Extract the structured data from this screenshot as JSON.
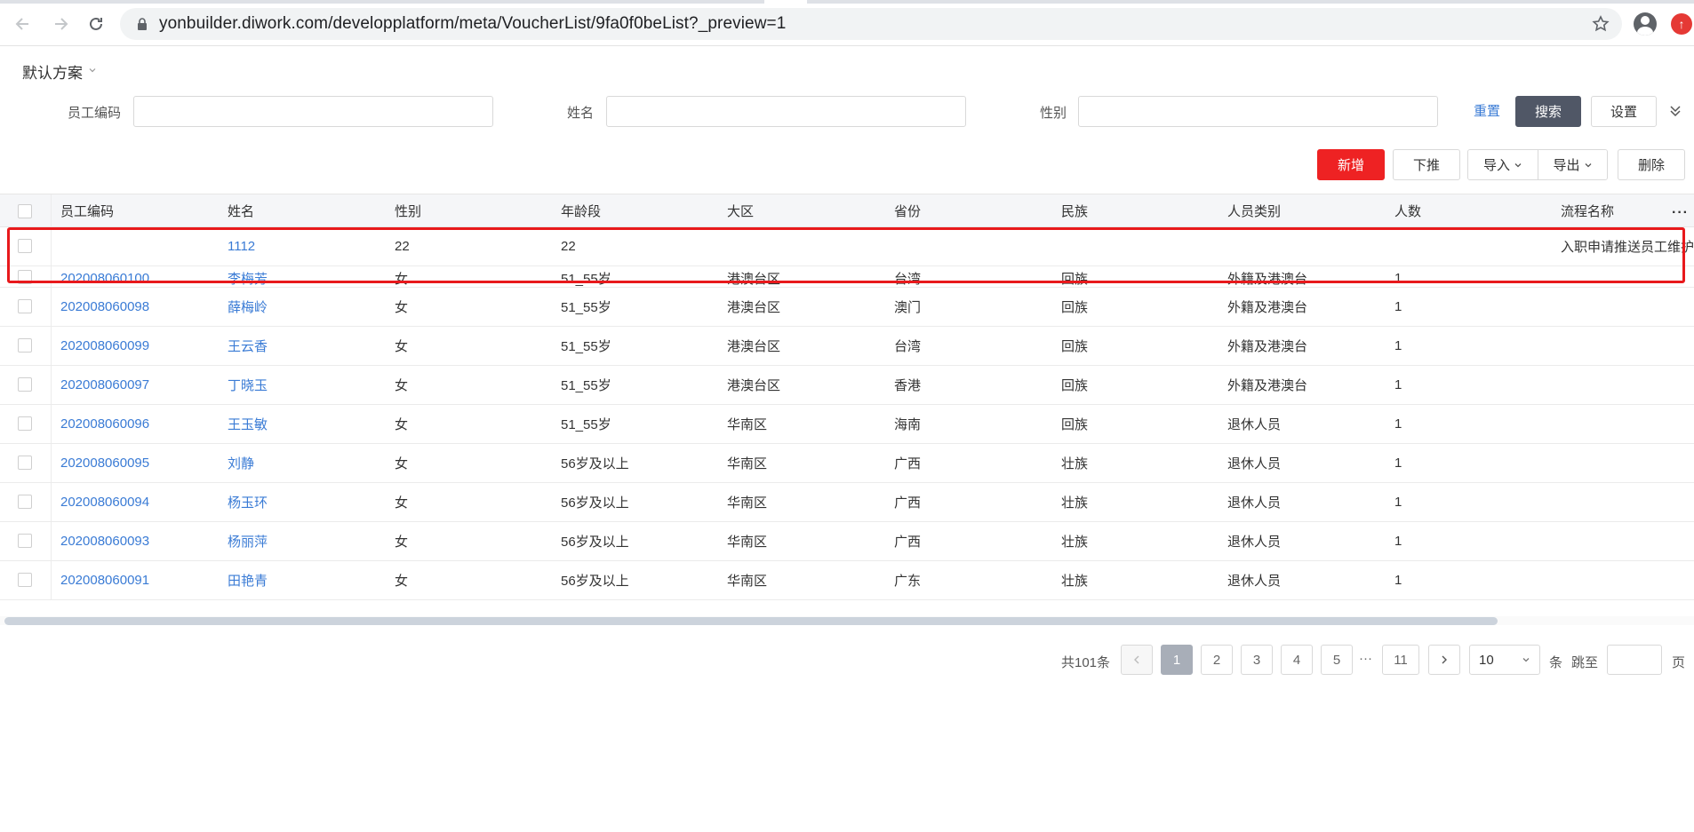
{
  "browser": {
    "url": "yonbuilder.diwork.com/developplatform/meta/VoucherList/9fa0f0beList?_preview=1"
  },
  "scheme": {
    "label": "默认方案"
  },
  "filters": [
    {
      "label": "员工编码",
      "value": ""
    },
    {
      "label": "姓名",
      "value": ""
    },
    {
      "label": "性别",
      "value": ""
    }
  ],
  "filter_actions": {
    "reset": "重置",
    "search": "搜索",
    "settings": "设置"
  },
  "toolbar": {
    "add": "新增",
    "push_down": "下推",
    "import": "导入",
    "export": "导出",
    "delete": "删除"
  },
  "table": {
    "columns": [
      "员工编码",
      "姓名",
      "性别",
      "年龄段",
      "大区",
      "省份",
      "民族",
      "人员类别",
      "人数",
      "流程名称"
    ],
    "rows": [
      [
        "",
        "1112",
        "22",
        "22",
        "",
        "",
        "",
        "",
        "",
        "入职申请推送员工维护"
      ],
      [
        "202008060100",
        "李梅芳",
        "女",
        "51_55岁",
        "港澳台区",
        "台湾",
        "回族",
        "外籍及港澳台",
        "1",
        ""
      ],
      [
        "202008060098",
        "薛梅岭",
        "女",
        "51_55岁",
        "港澳台区",
        "澳门",
        "回族",
        "外籍及港澳台",
        "1",
        ""
      ],
      [
        "202008060099",
        "王云香",
        "女",
        "51_55岁",
        "港澳台区",
        "台湾",
        "回族",
        "外籍及港澳台",
        "1",
        ""
      ],
      [
        "202008060097",
        "丁晓玉",
        "女",
        "51_55岁",
        "港澳台区",
        "香港",
        "回族",
        "外籍及港澳台",
        "1",
        ""
      ],
      [
        "202008060096",
        "王玉敏",
        "女",
        "51_55岁",
        "华南区",
        "海南",
        "回族",
        "退休人员",
        "1",
        ""
      ],
      [
        "202008060095",
        "刘静",
        "女",
        "56岁及以上",
        "华南区",
        "广西",
        "壮族",
        "退休人员",
        "1",
        ""
      ],
      [
        "202008060094",
        "杨玉环",
        "女",
        "56岁及以上",
        "华南区",
        "广西",
        "壮族",
        "退休人员",
        "1",
        ""
      ],
      [
        "202008060093",
        "杨丽萍",
        "女",
        "56岁及以上",
        "华南区",
        "广西",
        "壮族",
        "退休人员",
        "1",
        ""
      ],
      [
        "202008060091",
        "田艳青",
        "女",
        "56岁及以上",
        "华南区",
        "广东",
        "壮族",
        "退休人员",
        "1",
        ""
      ]
    ]
  },
  "pagination": {
    "total": "共101条",
    "pages": [
      "1",
      "2",
      "3",
      "4",
      "5",
      "11"
    ],
    "active_page": "1",
    "ellipsis": "···",
    "page_size": "10",
    "unit": "条",
    "jump_label": "跳至",
    "page_suffix": "页"
  },
  "colors": {
    "accent": "#3a7bd5",
    "primary_red": "#ee2223",
    "search_dark": "#505766",
    "highlight": "#e8191c"
  }
}
